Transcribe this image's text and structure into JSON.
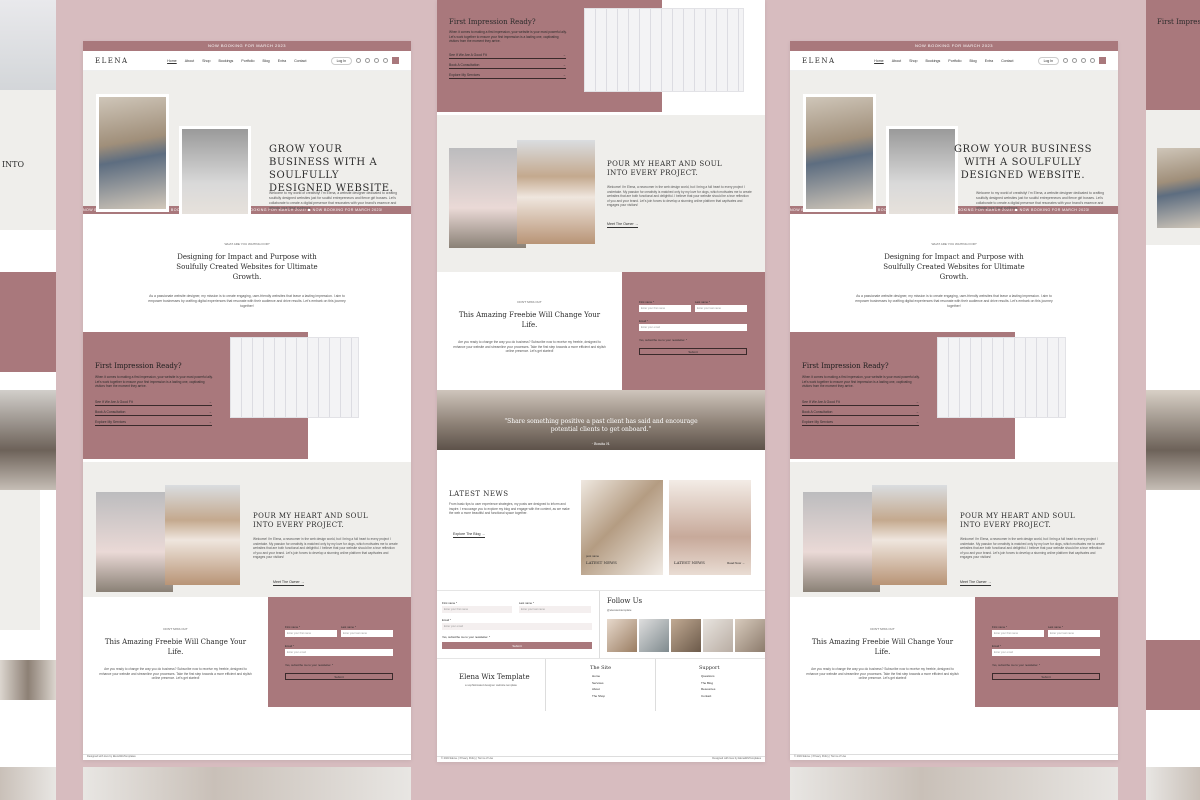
{
  "site": {
    "topbar": "NOW BOOKING FOR MARCH 2023",
    "logo": "ELENA",
    "nav": [
      "Home",
      "About",
      "Shop",
      "Bookings",
      "Portfolio",
      "Blog",
      "Extra",
      "Contact"
    ],
    "login": "Log In"
  },
  "hero": {
    "title": "GROW YOUR BUSINESS WITH A SOULFULLY DESIGNED WEBSITE.",
    "body": "Welcome to my world of creativity! I'm Elena, a website designer dedicated to crafting soulfully designed websites just for soulful entrepreneurs and fierce girl bosses. Let's collaborate to create a digital presence that resonates with your brand's essence and attracts your ideal audience.",
    "cta": "Explore My Services →"
  },
  "ticker": "NOW BOOKING FOR MARCH 2023!   ☗   NOW BOOKING FOR MARCH 2023!   ☗   NOW BOOKING FOR MARCH 2023!   ☗   NOW BOOKING FOR MARCH 2023!",
  "intro": {
    "eyebrow": "WHAT ARE YOU WAITING FOR?",
    "title": "Designing for Impact and Purpose with Soulfully Created Websites for Ultimate Growth.",
    "body": "As a passionate website designer, my mission is to create engaging, user-friendly websites that leave a lasting impression. I aim to empower businesses by crafting digital experiences that resonate with their audience and drive results. Let's embark on this journey together!"
  },
  "impression": {
    "title": "First Impression Ready?",
    "body": "When it comes to making a first impression, your website is your most powerful ally. Let's work together to ensure your first impression is a lasting one, captivating visitors from the moment they arrive.",
    "links": [
      "See If We Are A Good Fit",
      "Book A Consultation",
      "Explore My Services"
    ]
  },
  "soul": {
    "title": "POUR MY HEART AND SOUL INTO EVERY PROJECT.",
    "body": "Welcome! I'm Elena, a newcomer in the web design world, but I bring a full heart to every project I undertake. My passion for creativity is matched only by my love for dogs, which motivates me to create websites that are both functional and delightful. I believe that your website should be a true reflection of you and your brand. Let's join forces to develop a stunning online platform that captivates and engages your visitors!",
    "cta": "Meet The Owner →"
  },
  "freebie": {
    "eyebrow": "DON'T MISS OUT",
    "title": "This Amazing Freebie Will Change Your Life.",
    "body": "Are you ready to change the way you do business? Subscribe now to receive my freebie, designed to enhance your website and streamline your processes. Take the first step towards a more efficient and stylish online presence. Let's get started!",
    "first_name_label": "First name *",
    "last_name_label": "Last name *",
    "first_name_placeholder": "Enter your first name",
    "last_name_placeholder": "Enter your last name",
    "email_label": "Email *",
    "email_placeholder": "Enter your email",
    "checkbox": "Yes, subscribe me to your newsletter. *",
    "submit": "Submit"
  },
  "testimonial": "\"Share something positive a past client has said and encourage potential clients to get onboard.\"",
  "testimonial_author": "- Bonita H.",
  "news": {
    "title": "LATEST NEWS",
    "body": "From basic tips to user experience strategies, my posts are designed to inform and inspire. I encourage you to explore my blog and engage with the content, as we make the web a more beautiful and functional space together.",
    "cta": "Explore The Blog →",
    "card_title": "LATEST NEWS",
    "card_meta": "post name",
    "card_cta": "Read Now →"
  },
  "follow": {
    "title": "Follow Us",
    "handle": "@elenawixtemplate"
  },
  "footer": {
    "brand": "Elena Wix Template",
    "tagline": "a sophisticated designer website template",
    "col1_title": "The Site",
    "col1": [
      "Home",
      "Services",
      "About",
      "The Shop"
    ],
    "col2_title": "Support",
    "col2": [
      "Questions",
      "The Blog",
      "Resources",
      "Contact"
    ],
    "copyright": "© 2023 Elena. | Privacy Policy | Terms of Use",
    "credit": "Designed with love by ElenaWixTemplates"
  },
  "colors": {
    "accent": "#a9787c",
    "background": "#d7bcbf",
    "light": "#efeeeb"
  }
}
